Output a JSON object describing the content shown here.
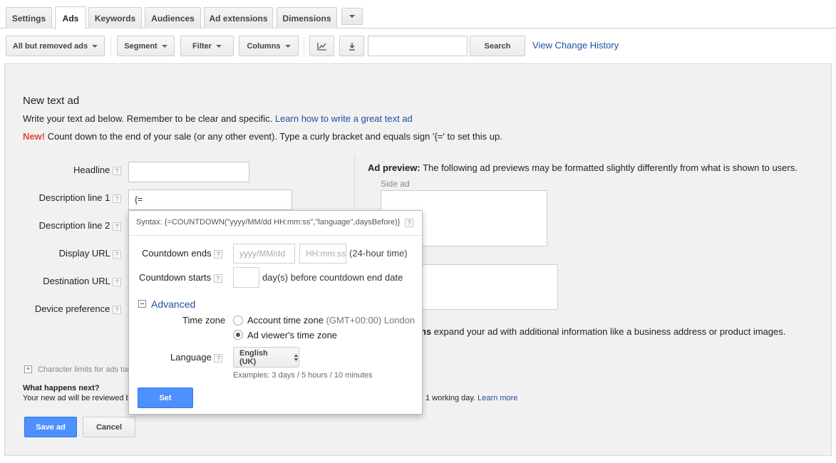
{
  "tabs": [
    {
      "label": "Settings"
    },
    {
      "label": "Ads"
    },
    {
      "label": "Keywords"
    },
    {
      "label": "Audiences"
    },
    {
      "label": "Ad extensions"
    },
    {
      "label": "Dimensions"
    }
  ],
  "toolbar": {
    "view_filter": "All but removed ads",
    "segment": "Segment",
    "filter": "Filter",
    "columns": "Columns",
    "search_button": "Search",
    "search_value": "",
    "history_link": "View Change History"
  },
  "form": {
    "title": "New text ad",
    "intro": "Write your text ad below. Remember to be clear and specific.",
    "intro_link": "Learn how to write a great text ad",
    "new_badge": "New!",
    "new_text": "Count down to the end of your sale (or any other event). Type a curly bracket and equals sign '{=' to set this up.",
    "fields": {
      "headline": {
        "label": "Headline",
        "value": ""
      },
      "desc1": {
        "label": "Description line 1",
        "value": "{="
      },
      "desc2": {
        "label": "Description line 2"
      },
      "display_url": {
        "label": "Display URL"
      },
      "dest_url": {
        "label": "Destination URL"
      },
      "device": {
        "label": "Device preference"
      }
    },
    "char_limits": "Character limits for ads tar",
    "next_title": "What happens next?",
    "next_text": "Your new ad will be reviewed b",
    "next_tail": "1 working day.",
    "learn_more": "Learn more",
    "save": "Save ad",
    "cancel": "Cancel",
    "help_glyph": "?"
  },
  "preview": {
    "label_bold": "Ad preview:",
    "label_text": "The following ad previews may be formatted slightly differently from what is shown to users.",
    "side_ad": "Side ad",
    "ext_bold": "ns",
    "ext_text": "expand your ad with additional information like a business address or product images."
  },
  "popup": {
    "syntax": "Syntax: {=COUNTDOWN(\"yyyy/MM/dd HH:mm:ss\",\"language\",daysBefore)}",
    "ends_label": "Countdown ends",
    "date_placeholder": "yyyy/MM/dd",
    "time_placeholder": "HH:mm:ss",
    "hour_note": "(24-hour time)",
    "starts_label": "Countdown starts",
    "days_value": "",
    "days_note": "day(s) before countdown end date",
    "advanced": "Advanced",
    "timezone_label": "Time zone",
    "tz_option1": "Account time zone",
    "tz_option1_detail": "(GMT+00:00) London",
    "tz_option2": "Ad viewer's time zone",
    "tz_selected": 2,
    "language_label": "Language",
    "language_value": "English (UK)",
    "examples": "Examples: 3 days / 5 hours / 10 minutes",
    "set": "Set"
  },
  "colors": {
    "link": "#1f4fa5",
    "new_badge": "#dd4b39",
    "primary": "#4d90fe"
  }
}
